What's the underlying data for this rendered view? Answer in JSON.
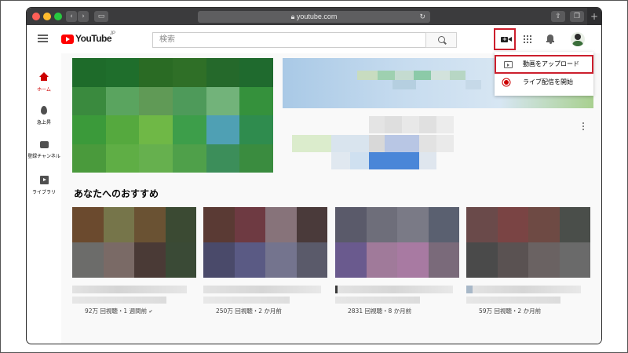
{
  "browser": {
    "url": "youtube.com",
    "traffic_lights": [
      "close",
      "minimize",
      "zoom"
    ]
  },
  "header": {
    "logo_text": "YouTube",
    "logo_region": "JP",
    "search_placeholder": "検索",
    "avatar_colors": {
      "hair": "#2b2b2b",
      "shirt": "#3a6e3a"
    }
  },
  "sidebar": {
    "items": [
      {
        "label": "ホーム",
        "icon": "home-icon",
        "active": true
      },
      {
        "label": "急上昇",
        "icon": "fire-icon",
        "active": false
      },
      {
        "label": "登録チャンネル",
        "icon": "subscriptions-icon",
        "active": false
      },
      {
        "label": "ライブラリ",
        "icon": "library-icon",
        "active": false
      }
    ]
  },
  "create_menu": {
    "items": [
      {
        "label": "動画をアップロード",
        "icon": "upload-video-icon",
        "highlighted": true
      },
      {
        "label": "ライブ配信を開始",
        "icon": "go-live-icon",
        "highlighted": false
      }
    ]
  },
  "main": {
    "section_title": "あなたへのおすすめ",
    "featured_colors": [
      "#1e6b2a",
      "#1f6e2c",
      "#2a6b24",
      "#2f6f27",
      "#25692b",
      "#1f6a2e",
      "#3a8a3e",
      "#5aa45f",
      "#609a56",
      "#4e9a5a",
      "#72b37a",
      "#35913c",
      "#3b9a3a",
      "#55a93e",
      "#6fb846",
      "#3d9e4a",
      "#4fa0b4",
      "#2f8c4e",
      "#4a9a3c",
      "#5fae45",
      "#66b04e",
      "#4fa04a",
      "#3c8e5a",
      "#3a8c3f"
    ],
    "cards": [
      {
        "views": "92万 回視聴・1 週間前",
        "verified": true,
        "colors": [
          "#6b4a2e",
          "#76754a",
          "#6a5233",
          "#3b4a33",
          "#6c6c6a",
          "#7a6a66",
          "#4a3a36",
          "#3a4a36"
        ]
      },
      {
        "views": "250万 回視聴・2 か月前",
        "verified": false,
        "colors": [
          "#5a3a34",
          "#6e3a42",
          "#87737a",
          "#4a3a3a",
          "#4a4a6a",
          "#5a5a84",
          "#74748e",
          "#5a5a6a"
        ]
      },
      {
        "views": "2831 回視聴・8 か月前",
        "verified": false,
        "colors": [
          "#5a5a6a",
          "#6e6e7a",
          "#7a7a86",
          "#5a6070",
          "#6a5a8e",
          "#a07a9a",
          "#a87aa2",
          "#7a6a7a"
        ]
      },
      {
        "views": "59万 回視聴・2 か月前",
        "verified": false,
        "colors": [
          "#6a4a4a",
          "#7a4444",
          "#6e4a44",
          "#4a4e4a",
          "#4a4a4a",
          "#5a5252",
          "#6a6262",
          "#6a6a6a"
        ]
      }
    ]
  },
  "colors": {
    "brand_red": "#ff0000",
    "highlight_red": "#cc1f2d",
    "active_red": "#cc0000"
  }
}
